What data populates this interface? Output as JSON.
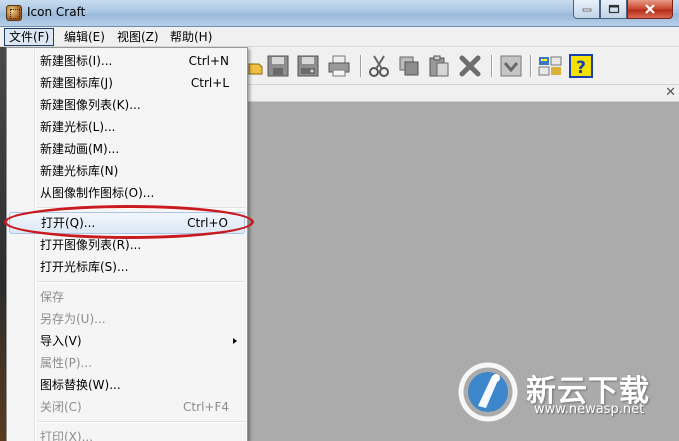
{
  "window": {
    "title": "Icon Craft",
    "icon": "app-icon",
    "controls": [
      "minimize-icon",
      "maximize-icon",
      "close-icon"
    ]
  },
  "menubar": {
    "items": [
      {
        "label": "文件(F)",
        "open": true
      },
      {
        "label": "编辑(E)"
      },
      {
        "label": "视图(Z)"
      },
      {
        "label": "帮助(H)"
      }
    ]
  },
  "file_menu": {
    "items": [
      {
        "label": "新建图标(I)...",
        "shortcut": "Ctrl+N"
      },
      {
        "label": "新建图标库(J)",
        "shortcut": "Ctrl+L"
      },
      {
        "label": "新建图像列表(K)..."
      },
      {
        "label": "新建光标(L)..."
      },
      {
        "label": "新建动画(M)..."
      },
      {
        "label": "新建光标库(N)"
      },
      {
        "label": "从图像制作图标(O)..."
      },
      {
        "label": "打开(Q)...",
        "shortcut": "Ctrl+O",
        "highlighted": true
      },
      {
        "label": "打开图像列表(R)..."
      },
      {
        "label": "打开光标库(S)..."
      },
      {
        "label": "保存",
        "disabled": true
      },
      {
        "label": "另存为(U)...",
        "disabled": true
      },
      {
        "label": "导入(V)",
        "submenu": true
      },
      {
        "label": "属性(P)...",
        "disabled": true
      },
      {
        "label": "图标替换(W)..."
      },
      {
        "label": "关闭(C)",
        "shortcut": "Ctrl+F4",
        "disabled": true
      },
      {
        "label": "打印(X)...",
        "disabled": true
      }
    ]
  },
  "toolbar": {
    "icons": [
      "open-folder-icon",
      "save-icon",
      "save-all-icon",
      "print-icon",
      "cut-icon",
      "copy-icon",
      "paste-icon",
      "delete-icon",
      "check-icon",
      "properties-icon",
      "help-icon"
    ]
  },
  "watermark": {
    "brand": "新云下载",
    "url": "www.newasp.net"
  },
  "colors": {
    "highlight_ring": "#c91a1f",
    "workspace": "#ababab"
  }
}
